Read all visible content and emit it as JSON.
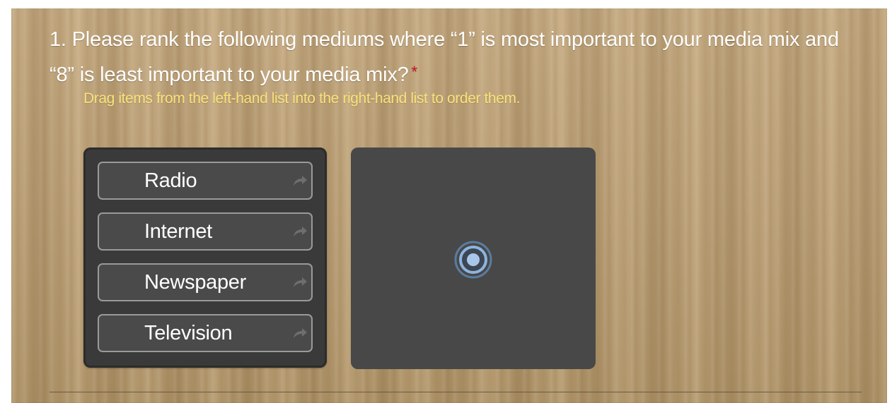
{
  "question": {
    "title": "1. Please rank the following mediums where “1” is most important to your media mix and “8” is least important to your media mix?",
    "required_marker": "*",
    "instructions": "Drag items from the left-hand list into the right-hand list to order them."
  },
  "ranking": {
    "source_items": [
      {
        "label": "Radio",
        "icon": "move-right-arrow-icon"
      },
      {
        "label": "Internet",
        "icon": "move-right-arrow-icon"
      },
      {
        "label": "Newspaper",
        "icon": "move-right-arrow-icon"
      },
      {
        "label": "Television",
        "icon": "move-right-arrow-icon"
      }
    ],
    "target_items": [],
    "target_indicator_icon": "drop-target-icon"
  },
  "colors": {
    "title_text": "#ffffff",
    "instructions_text": "#f8e27a",
    "required_marker": "#d0182a",
    "list_background": "#3a3a3a",
    "target_background": "#484848",
    "item_border": "#9a9a9a",
    "indicator_ring": "#7aa6d6"
  }
}
